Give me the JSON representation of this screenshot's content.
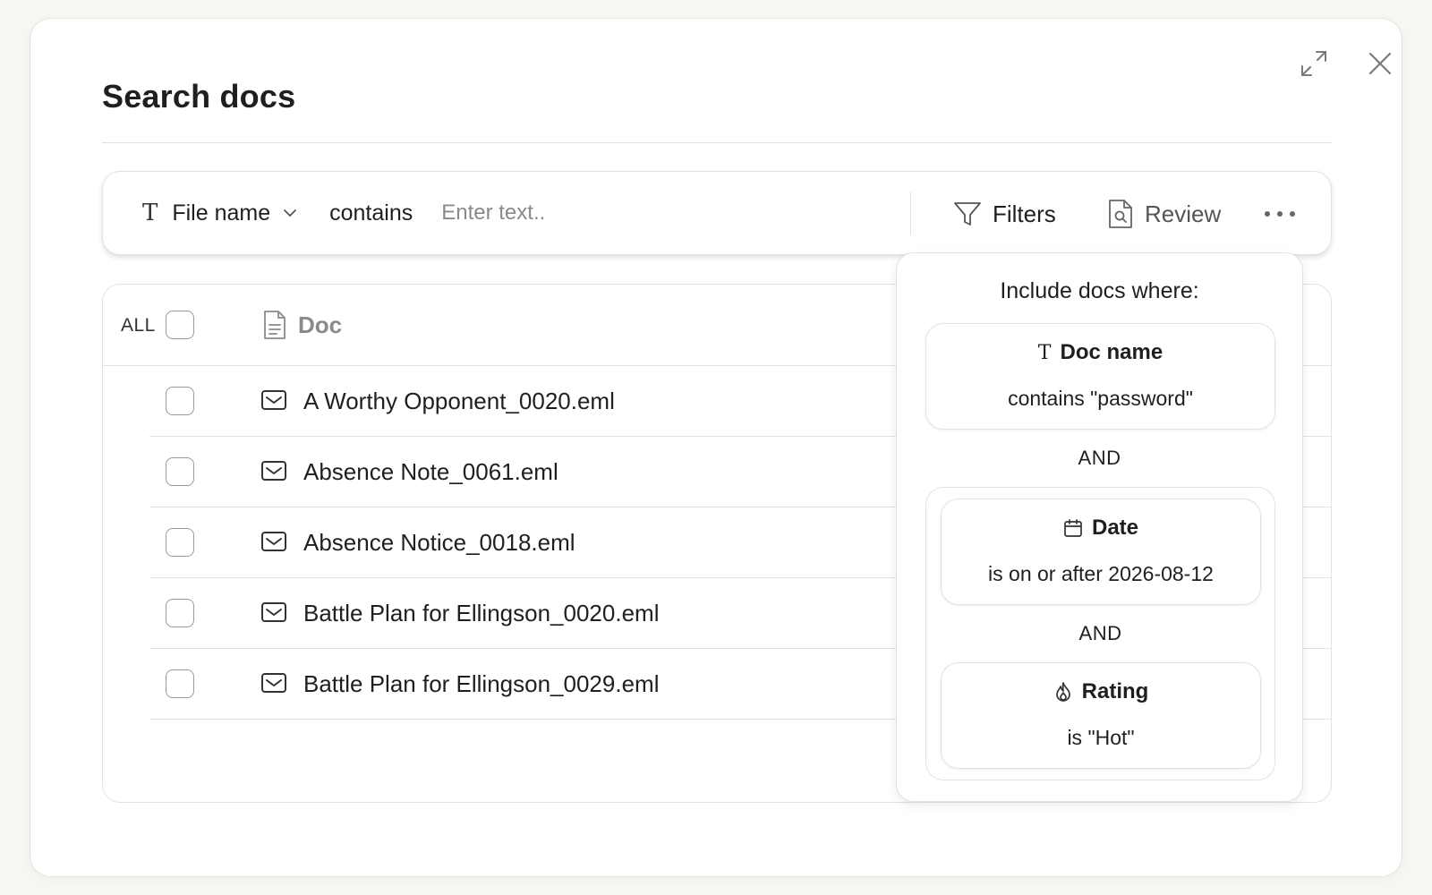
{
  "modal": {
    "title": "Search docs"
  },
  "search": {
    "field_label": "File name",
    "operator_label": "contains",
    "input_value": "",
    "input_placeholder": "Enter text..",
    "filters_label": "Filters",
    "review_label": "Review"
  },
  "table": {
    "all_label": "ALL",
    "doc_column": "Doc",
    "rows": [
      {
        "name": "A Worthy Opponent_0020.eml",
        "icon": "mail-icon"
      },
      {
        "name": "Absence Note_0061.eml",
        "icon": "mail-icon"
      },
      {
        "name": "Absence Notice_0018.eml",
        "icon": "mail-icon"
      },
      {
        "name": "Battle Plan for Ellingson_0020.eml",
        "icon": "mail-icon"
      },
      {
        "name": "Battle Plan for Ellingson_0029.eml",
        "icon": "mail-icon"
      }
    ]
  },
  "filters_popover": {
    "heading": "Include docs where:",
    "conditions": [
      {
        "icon": "text-type-icon",
        "title": "Doc name",
        "description": "contains \"password\""
      },
      {
        "icon": "calendar-icon",
        "title": "Date",
        "description": "is on or after 2026-08-12"
      },
      {
        "icon": "flame-icon",
        "title": "Rating",
        "description": "is \"Hot\""
      }
    ],
    "connectors": [
      "AND",
      "AND"
    ]
  },
  "colors": {
    "background": "#f7f6f2",
    "border": "#e4e2dc",
    "muted_text": "#8a8a8a",
    "primary_text": "#1f1f1f"
  }
}
